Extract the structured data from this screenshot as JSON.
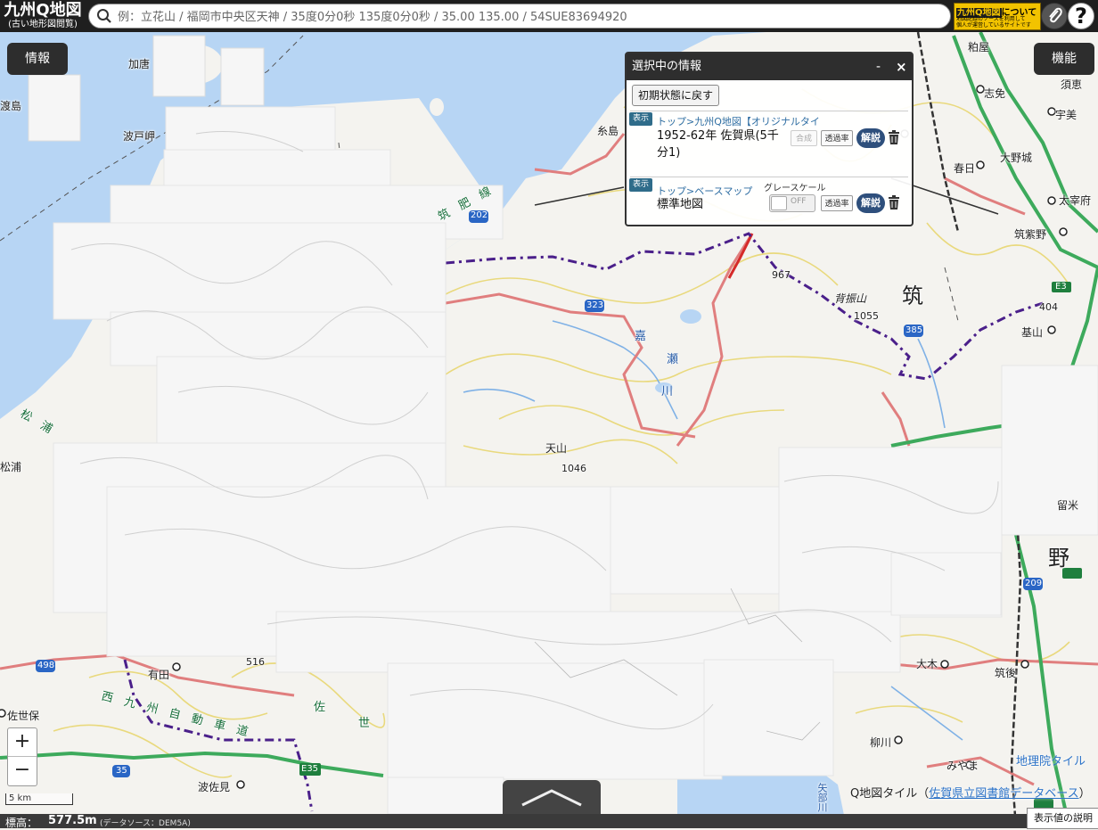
{
  "app": {
    "logo_main": "九州Q地図",
    "logo_sub": "(古い地形図閲覧)",
    "about_badge_title": "九州Q地図",
    "about_badge_suffix": "について",
    "about_badge_sub1": "地図記録のソースを利用して",
    "about_badge_sub2": "個人が運営しているサイトです",
    "help_label": "?"
  },
  "search": {
    "placeholder": "例：立花山 / 福岡市中央区天神 / 35度0分0秒 135度0分0秒 / 35.00 135.00 / 54SUE83694920"
  },
  "buttons": {
    "info": "情報",
    "functions": "機能"
  },
  "panel": {
    "title": "選択中の情報",
    "minimize": "-",
    "close": "×",
    "reset": "初期状態に戻す",
    "layers": [
      {
        "show": "表示",
        "path": "トップ>九州Q地図【オリジナルタイ",
        "name": "1952-62年 佐賀県(5千分1)",
        "composite": "合成",
        "opacity": "透過率",
        "explain": "解説"
      },
      {
        "show": "表示",
        "path": "トップ>ベースマップ",
        "name": "標準地図",
        "grayscale": "グレースケール",
        "toggle": "OFF",
        "opacity": "透過率",
        "explain": "解説"
      }
    ]
  },
  "map": {
    "labels": {
      "kakara": "加唐",
      "watarishima": "渡島",
      "hatozaki": "波戸岬",
      "itoshima": "糸島",
      "chikuhisen": "筑　肥　線",
      "r202": "202",
      "r323": "323",
      "r385": "385",
      "r498": "498",
      "r35": "35",
      "r209": "209",
      "e3": "E3",
      "e35": "E35",
      "p967": "967",
      "sefuri": "背振山",
      "p1055": "1055",
      "p404": "404",
      "tenzan": "天山",
      "p1046": "1046",
      "kasegawa1": "嘉",
      "kasegawa2": "瀬",
      "kasegawa3": "川",
      "chiku_big": "筑",
      "no_big": "野",
      "kishima": "基山",
      "chikushino": "筑紫野",
      "dazaifu": "太宰府",
      "kasuga": "春日",
      "onojo": "大野城",
      "kasuya": "粕屋",
      "shime": "志免",
      "sue": "須恵",
      "umi": "宇美",
      "matsuura_label": "松浦",
      "matsuura_river": "松　浦",
      "arita": "有田",
      "p516": "516",
      "sasebo": "佐世保",
      "hasami": "波佐見",
      "saga_label": "佐",
      "saga_label2": "世",
      "kyushu_exp": "西　九　州　自　動　車　道",
      "oki": "大木",
      "chikugo": "筑後",
      "yanagawa": "柳川",
      "miyama": "みやま",
      "kurume": "留米",
      "yabe": "矢部川"
    }
  },
  "attribution": {
    "gsi": "地理院タイル",
    "q_prefix": "Q地図タイル（",
    "q_link": "佐賀県立図書館データベース",
    "q_suffix": "）"
  },
  "scale": "5 km",
  "bottom": {
    "elevation_label": "標高：",
    "elevation": "577.5m",
    "source": "(データソース：DEM5A)",
    "explain_values": "表示値の説明"
  },
  "zoom": {
    "in": "+",
    "out": "−"
  },
  "colors": {
    "sea": "#b7d5f4",
    "land": "#f4f3ef",
    "overlay": "#f7f7f7",
    "road_red": "#e07e7e",
    "contour": "#e9d97d",
    "pref_boundary": "#4a1f8a",
    "highway_green": "#3daa5c"
  }
}
